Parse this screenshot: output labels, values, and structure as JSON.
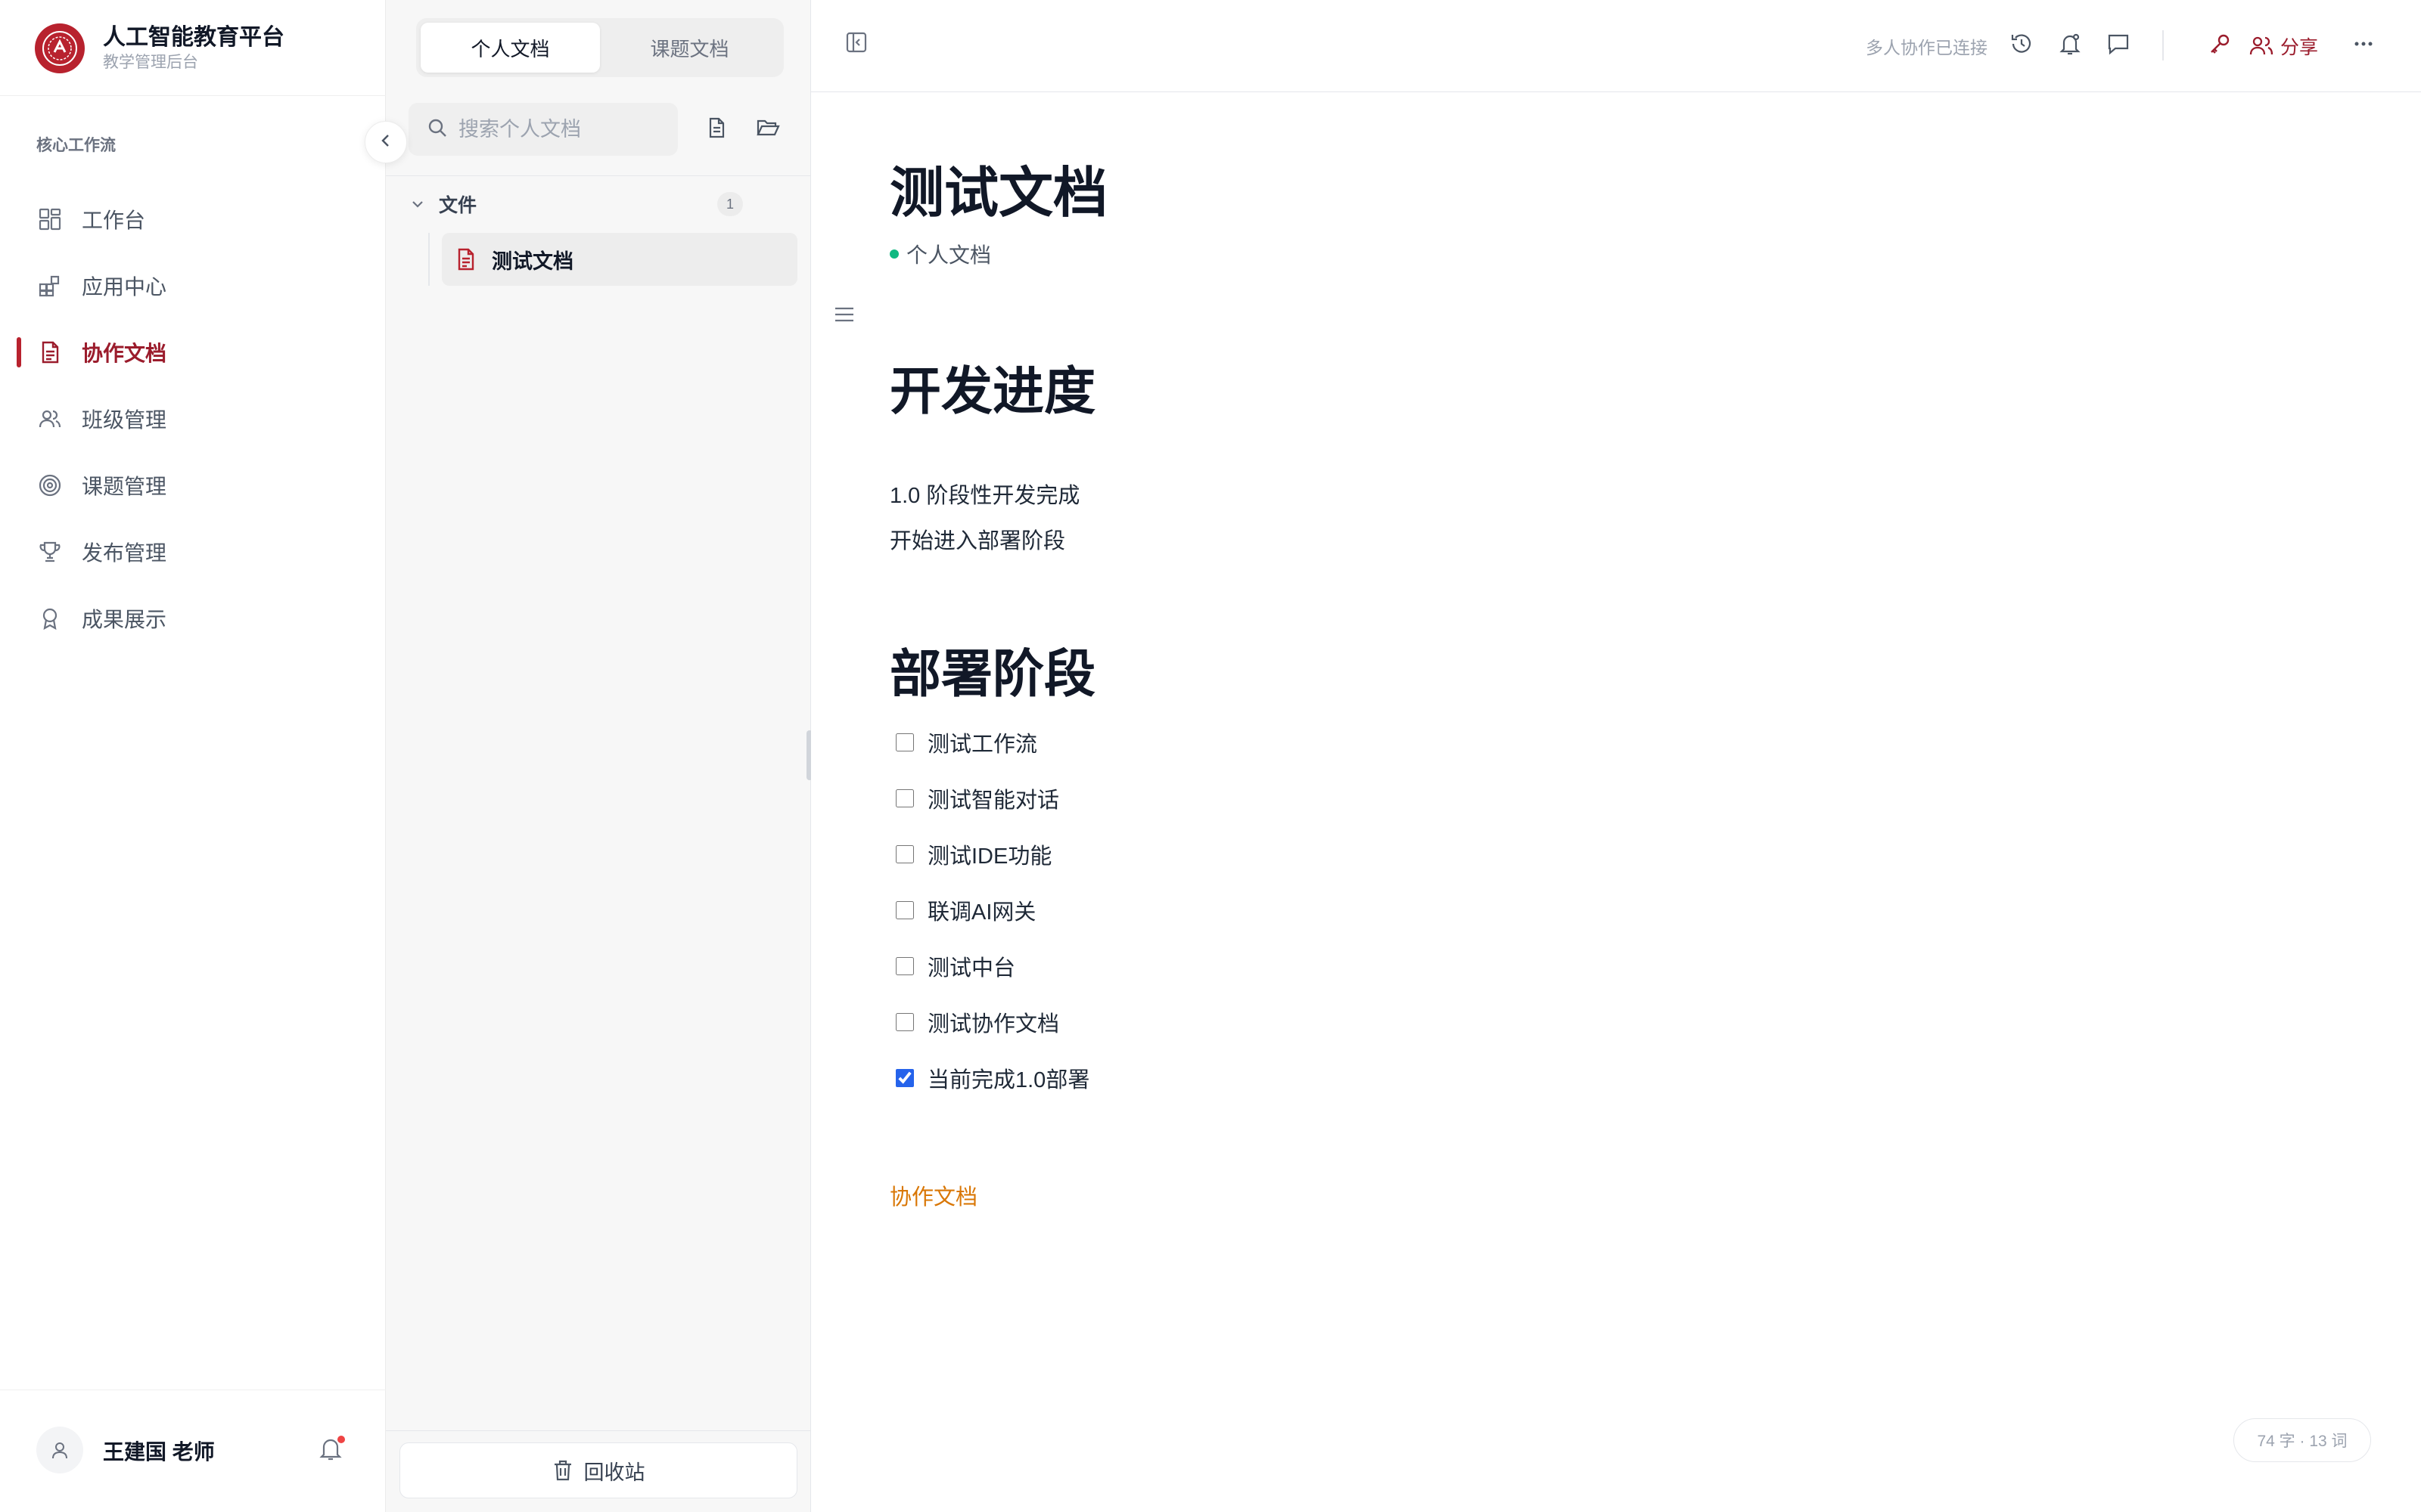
{
  "brand": {
    "title": "人工智能教育平台",
    "subtitle": "教学管理后台",
    "logo_text": "AI"
  },
  "sidebar": {
    "section_label": "核心工作流",
    "items": [
      {
        "label": "工作台",
        "icon": "dashboard-icon"
      },
      {
        "label": "应用中心",
        "icon": "apps-icon"
      },
      {
        "label": "协作文档",
        "icon": "document-icon",
        "active": true
      },
      {
        "label": "班级管理",
        "icon": "users-icon"
      },
      {
        "label": "课题管理",
        "icon": "target-icon"
      },
      {
        "label": "发布管理",
        "icon": "trophy-icon"
      },
      {
        "label": "成果展示",
        "icon": "award-icon"
      }
    ],
    "user": {
      "name": "王建国 老师"
    }
  },
  "doc_panel": {
    "tabs": [
      {
        "label": "个人文档",
        "active": true
      },
      {
        "label": "课题文档",
        "active": false
      }
    ],
    "search_placeholder": "搜索个人文档",
    "folder": {
      "name": "文件",
      "count": "1"
    },
    "documents": [
      {
        "title": "测试文档",
        "selected": true
      }
    ],
    "trash_label": "回收站"
  },
  "editor": {
    "collab_status": "多人协作已连接",
    "share_label": "分享",
    "title": "测试文档",
    "meta": "个人文档",
    "sections": [
      {
        "heading": "开发进度",
        "paragraphs": [
          "1.0 阶段性开发完成",
          "开始进入部署阶段"
        ]
      },
      {
        "heading": "部署阶段",
        "tasks": [
          {
            "label": "测试工作流",
            "checked": false
          },
          {
            "label": "测试智能对话",
            "checked": false
          },
          {
            "label": "测试IDE功能",
            "checked": false
          },
          {
            "label": "联调AI网关",
            "checked": false
          },
          {
            "label": "测试中台",
            "checked": false
          },
          {
            "label": "测试协作文档",
            "checked": false
          },
          {
            "label": "当前完成1.0部署",
            "checked": true
          }
        ]
      }
    ],
    "link_text": "协作文档",
    "word_count": "74 字 · 13 词"
  },
  "colors": {
    "brand": "#b8222e",
    "active_text": "#9b1c2c",
    "link": "#d97706",
    "status_dot": "#10b981",
    "checkbox": "#2563eb"
  }
}
